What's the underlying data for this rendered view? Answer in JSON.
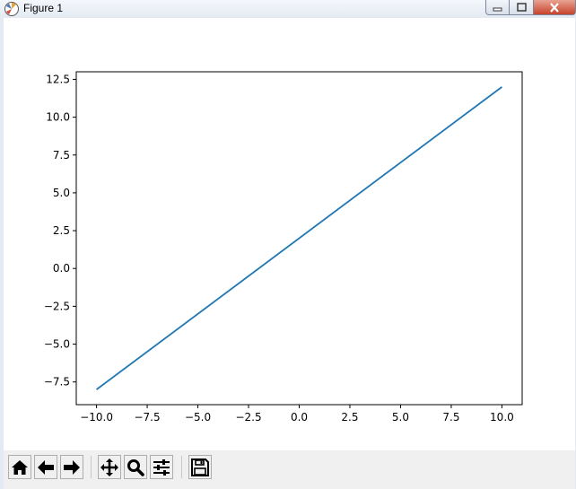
{
  "window": {
    "title": "Figure 1",
    "app_icon": "matplotlib-icon",
    "controls": [
      "minimize-icon",
      "maximize-icon",
      "close-icon"
    ]
  },
  "toolbar": {
    "buttons": [
      {
        "name": "home",
        "icon": "home-icon"
      },
      {
        "name": "back",
        "icon": "arrow-left-icon"
      },
      {
        "name": "forward",
        "icon": "arrow-right-icon"
      },
      {
        "name": "pan",
        "icon": "move-icon"
      },
      {
        "name": "zoom",
        "icon": "magnifier-icon"
      },
      {
        "name": "configure-subplots",
        "icon": "sliders-icon"
      },
      {
        "name": "save",
        "icon": "floppy-disk-icon"
      }
    ]
  },
  "chart_data": {
    "type": "line",
    "title": "",
    "xlabel": "",
    "ylabel": "",
    "xlim": [
      -11,
      11
    ],
    "ylim": [
      -9,
      13
    ],
    "xticks": [
      "−10.0",
      "−7.5",
      "−5.0",
      "−2.5",
      "0.0",
      "2.5",
      "5.0",
      "7.5",
      "10.0"
    ],
    "xtick_values": [
      -10,
      -7.5,
      -5,
      -2.5,
      0,
      2.5,
      5,
      7.5,
      10
    ],
    "yticks": [
      "−7.5",
      "−5.0",
      "−2.5",
      "0.0",
      "2.5",
      "5.0",
      "7.5",
      "10.0",
      "12.5"
    ],
    "ytick_values": [
      -7.5,
      -5,
      -2.5,
      0,
      2.5,
      5,
      7.5,
      10,
      12.5
    ],
    "grid": false,
    "series": [
      {
        "color": "#1f77b4",
        "x": [
          -10,
          10
        ],
        "y": [
          -8,
          12
        ]
      }
    ]
  }
}
